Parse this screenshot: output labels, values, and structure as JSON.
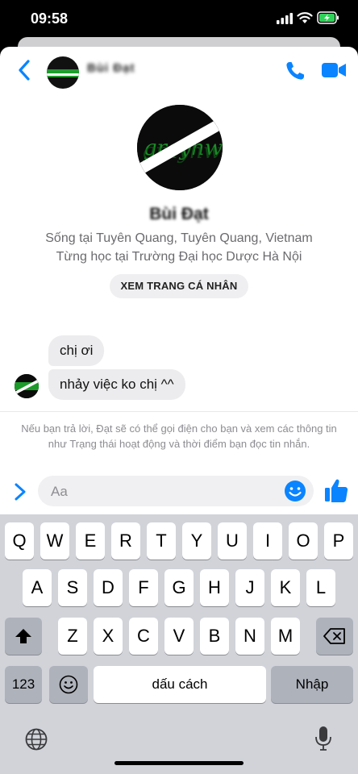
{
  "status_bar": {
    "time": "09:58"
  },
  "header": {
    "contact_name": "Bùi Đạt"
  },
  "profile": {
    "name": "Bùi Đạt",
    "lives_in": "Sống tại Tuyên Quang, Tuyên Quang, Vietnam",
    "studied_at": "Từng học tại Trường Đại học Dược Hà Nội",
    "view_profile_label": "XEM TRANG CÁ NHÂN"
  },
  "messages": [
    {
      "text": "chị ơi"
    },
    {
      "text": "nhảy việc ko chị ^^"
    }
  ],
  "notice": "Nếu bạn trả lời, Đạt sẽ có thể gọi điện cho bạn và xem các thông tin như Trạng thái hoạt động và thời điểm bạn đọc tin nhắn.",
  "composer": {
    "placeholder": "Aa"
  },
  "keyboard": {
    "row1": [
      "Q",
      "W",
      "E",
      "R",
      "T",
      "Y",
      "U",
      "I",
      "O",
      "P"
    ],
    "row2": [
      "A",
      "S",
      "D",
      "F",
      "G",
      "H",
      "J",
      "K",
      "L"
    ],
    "row3": [
      "Z",
      "X",
      "C",
      "V",
      "B",
      "N",
      "M"
    ],
    "numbers_key": "123",
    "space_key": "dấu cách",
    "return_key": "Nhập"
  },
  "colors": {
    "accent": "#0a84ff",
    "bubble": "#ececee",
    "keyboard_bg": "#d1d3d9"
  }
}
